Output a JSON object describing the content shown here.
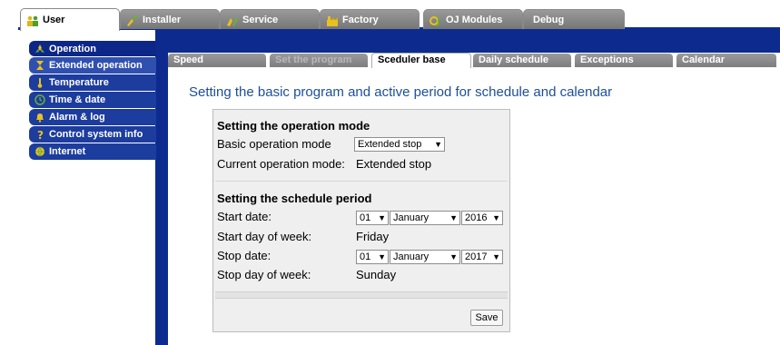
{
  "top_tabs": [
    {
      "label": "User",
      "active": true
    },
    {
      "label": "Installer"
    },
    {
      "label": "Service"
    },
    {
      "label": "Factory"
    },
    {
      "label": "OJ Modules"
    },
    {
      "label": "Debug"
    }
  ],
  "sidebar": {
    "items": [
      {
        "label": "Operation"
      },
      {
        "label": "Extended operation"
      },
      {
        "label": "Temperature"
      },
      {
        "label": "Time & date"
      },
      {
        "label": "Alarm & log"
      },
      {
        "label": "Control system info"
      },
      {
        "label": "Internet"
      }
    ]
  },
  "sub_tabs": [
    {
      "label": "Speed"
    },
    {
      "label": "Set the program",
      "disabled": true
    },
    {
      "label": "Sceduler base",
      "active": true
    },
    {
      "label": "Daily schedule"
    },
    {
      "label": "Exceptions"
    },
    {
      "label": "Calendar"
    }
  ],
  "main": {
    "heading": "Setting the basic program and active period for schedule and calendar",
    "operation_mode": {
      "title": "Setting the operation mode",
      "basic_label": "Basic operation mode",
      "basic_value": "Extended stop",
      "current_label": "Current operation mode:",
      "current_value": "Extended stop"
    },
    "schedule_period": {
      "title": "Setting the schedule period",
      "start_date_label": "Start date:",
      "start_day": "01",
      "start_month": "January",
      "start_year": "2016",
      "start_dow_label": "Start day of week:",
      "start_dow_value": "Friday",
      "stop_date_label": "Stop date:",
      "stop_day": "01",
      "stop_month": "January",
      "stop_year": "2017",
      "stop_dow_label": "Stop day of week:",
      "stop_dow_value": "Sunday"
    },
    "save_label": "Save"
  },
  "colors": {
    "navy": "#0d2b8f",
    "sidebar_blue": "#1c3c9e",
    "heading_blue": "#1d4e9a",
    "tab_gray": "#8a8a8a",
    "icon_yellow": "#e8c020"
  }
}
